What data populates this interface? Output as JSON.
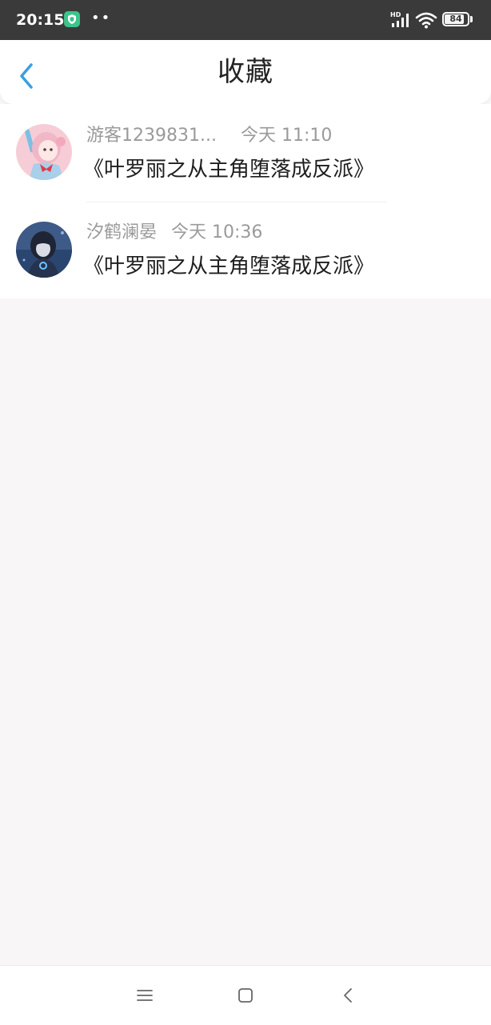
{
  "status_bar": {
    "time": "20:15",
    "battery": "84",
    "battery_level": 0.84,
    "network_label": "HD",
    "icons": [
      "shield-icon",
      "more-dots-icon",
      "signal-icon",
      "wifi-icon",
      "battery-icon"
    ]
  },
  "header": {
    "title": "收藏",
    "back_icon": "chevron-left-icon",
    "accent_color": "#3a9fe0"
  },
  "favorites": [
    {
      "username": "游客1239831...",
      "time": "今天 11:10",
      "title": "《叶罗丽之从主角堕落成反派》",
      "avatar": "pink-anime-girl-avatar"
    },
    {
      "username": "汐鹤澜晏",
      "time": "今天 10:36",
      "title": "《叶罗丽之从主角堕落成反派》",
      "avatar": "dark-hooded-anime-avatar"
    }
  ],
  "nav_bar": {
    "icons": [
      "menu-icon",
      "home-square-icon",
      "back-chevron-icon"
    ]
  }
}
